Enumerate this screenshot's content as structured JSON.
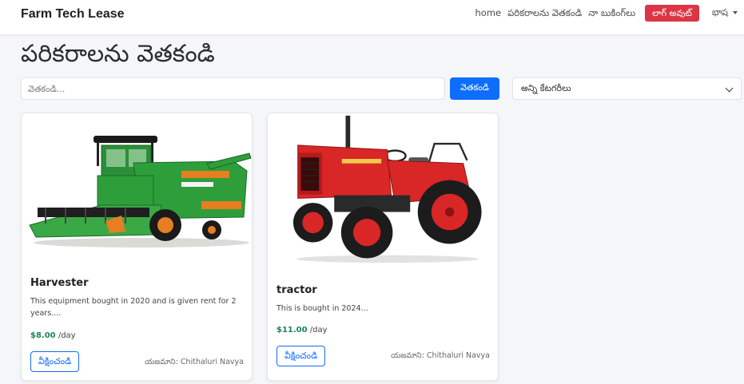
{
  "navbar": {
    "brand": "Farm Tech Lease",
    "links": [
      "home",
      "పరికరాలను వెతకండి",
      "నా బుకింగ్‌లు"
    ],
    "logout_label": "లాగ్ అవుట్",
    "language_label": "భాష"
  },
  "page": {
    "title": "పరికరాలను వెతకండి"
  },
  "search": {
    "placeholder": "వెతకండి...",
    "button_label": "వెతకండి",
    "category_selected": "అన్ని కేటగరీలు"
  },
  "cards": [
    {
      "title": "Harvester",
      "description": "This equipment bought in 2020 and is given rent for 2 years....",
      "price": "$8.00",
      "price_unit": "/day",
      "book_label": "వీక్షించండి",
      "owner": "యజమాని: Chithaluri Navya"
    },
    {
      "title": "tractor",
      "description": "This is bought in 2024...",
      "price": "$11.00",
      "price_unit": "/day",
      "book_label": "వీక్షించండి",
      "owner": "యజమాని: Chithaluri Navya"
    }
  ],
  "colors": {
    "primary": "#0d6efd",
    "danger": "#dc3545",
    "price": "#198754",
    "harvester_green": "#2e9e3a",
    "tractor_red": "#d92626"
  }
}
